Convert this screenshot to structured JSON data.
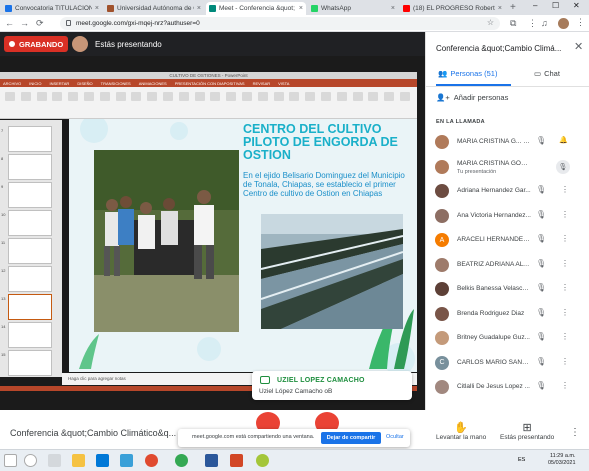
{
  "browser": {
    "tabs": [
      {
        "title": "Convocatoria TITULACIÓN II",
        "color": "#1a73e8"
      },
      {
        "title": "Universidad Autónoma de C",
        "color": "#a0522d"
      },
      {
        "title": "Meet - Conferencia &quot;",
        "color": "#00897b"
      },
      {
        "title": "WhatsApp",
        "color": "#25d366"
      },
      {
        "title": "(18) EL PROGRESO Roberto",
        "color": "#ff0000"
      }
    ],
    "url": "meet.google.com/gxi-mqej-nrz?authuser=0"
  },
  "meet": {
    "recording_label": "GRABANDO",
    "presenting_label": "Estás presentando",
    "meeting_name": "Conferencia &quot;Cambio Climático&q...",
    "share_notice": "meet.google.com está compartiendo una ventana.",
    "stop_share_label": "Dejar de compartir",
    "hide_label": "Ocultar",
    "raise_hand_label": "Levantar la mano",
    "presenting_now_label": "Estás presentando"
  },
  "slide": {
    "title": "CENTRO DEL CULTIVO PILOTO DE ENGORDA DE OSTION",
    "body": "En el ejido Belisario Dominguez del Municipio de Tonala, Chiapas, se establecio el primer Centro de cultivo de Ostion en Chiapas",
    "notes_placeholder": "Haga clic para agregar notas",
    "ribbon_tabs": [
      "ARCHIVO",
      "INICIO",
      "INSERTAR",
      "DISEÑO",
      "TRANSICIONES",
      "ANIMACIONES",
      "PRESENTACIÓN CON DIAPOSITIVAS",
      "REVISAR",
      "VISTA"
    ],
    "thumb_numbers": [
      "7",
      "8",
      "9",
      "10",
      "11",
      "12",
      "13",
      "14",
      "15"
    ]
  },
  "caption": {
    "speaker": "UZIEL LOPEZ CAMACHO",
    "text": "Uziel López Camacho oB"
  },
  "panel": {
    "title": "Conferencia &quot;Cambio Climá...",
    "people_tab": "Personas (51)",
    "chat_tab": "Chat",
    "add_people": "Añadir personas",
    "in_call": "EN LA LLAMADA",
    "participants": [
      {
        "name": "MARIA CRISTINA G... (Tú)",
        "sub": "",
        "avatar": "#b07a5a",
        "initial": ""
      },
      {
        "name": "MARIA CRISTINA GONZ...",
        "sub": "Tu presentación",
        "avatar": "#b07a5a",
        "initial": ""
      },
      {
        "name": "Adriana Hernandez Gar...",
        "sub": "",
        "avatar": "#6d4c41",
        "initial": ""
      },
      {
        "name": "Ana Victoria Hernandez...",
        "sub": "",
        "avatar": "#8d6e63",
        "initial": ""
      },
      {
        "name": "ARACELI HERNANDEZ ...",
        "sub": "",
        "avatar": "#f57c00",
        "initial": "A"
      },
      {
        "name": "BEATRIZ ADRIANA ALVA...",
        "sub": "",
        "avatar": "#9e7b6b",
        "initial": ""
      },
      {
        "name": "Belkis Banessa Velasco ...",
        "sub": "",
        "avatar": "#5d4037",
        "initial": ""
      },
      {
        "name": "Brenda Rodriguez Diaz",
        "sub": "",
        "avatar": "#795548",
        "initial": ""
      },
      {
        "name": "Britney Guadalupe Guz...",
        "sub": "",
        "avatar": "#c49a7a",
        "initial": ""
      },
      {
        "name": "CARLOS MARIO SANC...",
        "sub": "",
        "avatar": "#78909c",
        "initial": "C"
      },
      {
        "name": "Citlalli De Jesus Lopez ...",
        "sub": "",
        "avatar": "#a1887f",
        "initial": ""
      }
    ]
  },
  "taskbar": {
    "lang": "ES",
    "time": "11:29 a.m.",
    "date": "05/03/2021"
  }
}
